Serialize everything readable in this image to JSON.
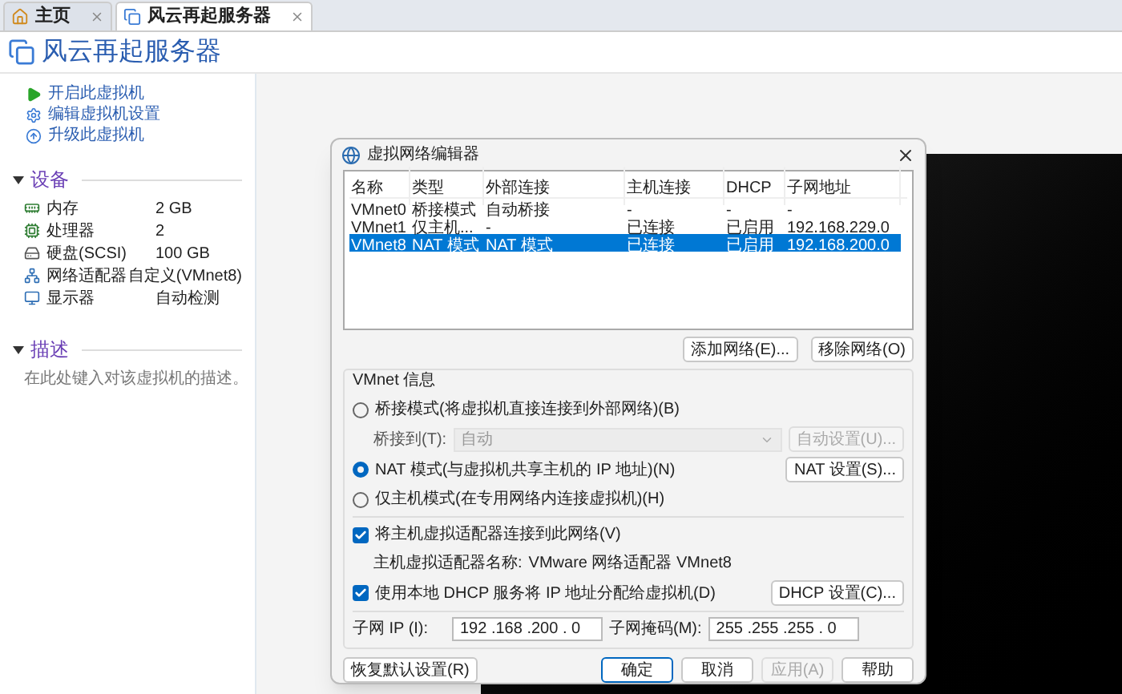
{
  "tabs": [
    {
      "label": "主页",
      "selected": false
    },
    {
      "label": "风云再起服务器",
      "selected": true
    }
  ],
  "vm_title": "风云再起服务器",
  "actions": [
    {
      "label": "开启此虚拟机"
    },
    {
      "label": "编辑虚拟机设置"
    },
    {
      "label": "升级此虚拟机"
    }
  ],
  "devices": {
    "heading": "设备",
    "expanded": true,
    "items": [
      {
        "name": "内存",
        "value": "2 GB"
      },
      {
        "name": "处理器",
        "value": "2"
      },
      {
        "name": "硬盘(SCSI)",
        "value": "100 GB"
      },
      {
        "name": "网络适配器",
        "value": "自定义(VMnet8)"
      },
      {
        "name": "显示器",
        "value": "自动检测"
      }
    ]
  },
  "description": {
    "heading": "描述",
    "expanded": true,
    "placeholder": "在此处键入对该虚拟机的描述。"
  },
  "dialog": {
    "title": "虚拟网络编辑器",
    "table": {
      "columns": [
        "名称",
        "类型",
        "外部连接",
        "主机连接",
        "DHCP",
        "子网地址"
      ],
      "rows": [
        {
          "cells": [
            "VMnet0",
            "桥接模式",
            "自动桥接",
            "-",
            "-",
            "-"
          ],
          "selected": false
        },
        {
          "cells": [
            "VMnet1",
            "仅主机...",
            "-",
            "已连接",
            "已启用",
            "192.168.229.0"
          ],
          "selected": false
        },
        {
          "cells": [
            "VMnet8",
            "NAT 模式",
            "NAT 模式",
            "已连接",
            "已启用",
            "192.168.200.0"
          ],
          "selected": true
        }
      ]
    },
    "list_buttons": [
      "添加网络(E)...",
      "移除网络(O)"
    ],
    "group_title": "VMnet 信息",
    "modes": [
      {
        "label": "桥接模式(将虚拟机直接连接到外部网络)(B)",
        "selected": false
      },
      {
        "label": "NAT 模式(与虚拟机共享主机的 IP 地址)(N)",
        "selected": true
      },
      {
        "label": "仅主机模式(在专用网络内连接虚拟机)(H)",
        "selected": false
      }
    ],
    "bridge": {
      "label": "桥接到(T):",
      "value": "自动",
      "button": "自动设置(U)...",
      "disabled": true
    },
    "nat_button": "NAT 设置(S)...",
    "host_adapter": {
      "label": "将主机虚拟适配器连接到此网络(V)",
      "checked": true,
      "name_label": "主机虚拟适配器名称:",
      "name_value": "VMware 网络适配器 VMnet8"
    },
    "dhcp": {
      "label": "使用本地 DHCP 服务将 IP 地址分配给虚拟机(D)",
      "checked": true,
      "button": "DHCP 设置(C)..."
    },
    "subnet_ip": {
      "label": "子网 IP (I):",
      "value": "192 .168 .200 . 0"
    },
    "subnet_mask": {
      "label": "子网掩码(M):",
      "value": "255 .255 .255 . 0"
    },
    "restore_button": "恢复默认设置(R)",
    "buttons": [
      {
        "label": "确定",
        "default": true,
        "disabled": false
      },
      {
        "label": "取消",
        "default": false,
        "disabled": false
      },
      {
        "label": "应用(A)",
        "default": false,
        "disabled": true
      },
      {
        "label": "帮助",
        "default": false,
        "disabled": false
      }
    ]
  }
}
